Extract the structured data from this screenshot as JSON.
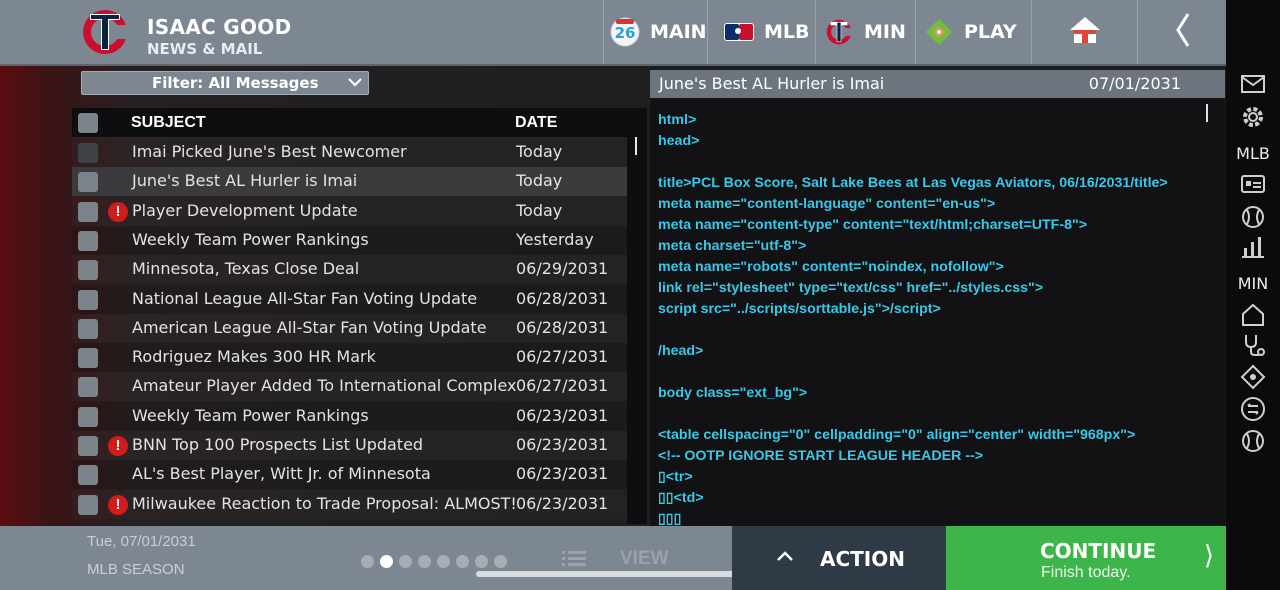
{
  "header": {
    "team_name": "ISAAC GOOD",
    "section": "NEWS & MAIL",
    "nav": [
      {
        "label": "MAIN",
        "icon": "calendar-26-icon"
      },
      {
        "label": "MLB",
        "icon": "mlb-logo-icon"
      },
      {
        "label": "MIN",
        "icon": "twins-logo-icon"
      },
      {
        "label": "PLAY",
        "icon": "baseball-diamond-icon"
      }
    ],
    "home_icon": "home-icon",
    "back_icon": "chevron-left-icon",
    "calendar_day": "26"
  },
  "filter": {
    "label": "Filter: All Messages"
  },
  "list": {
    "columns": {
      "subject": "SUBJECT",
      "date": "DATE"
    },
    "rows": [
      {
        "subject": "Imai Picked June's Best Newcomer",
        "date": "Today",
        "alert": false
      },
      {
        "subject": "June's Best AL Hurler is Imai",
        "date": "Today",
        "alert": false,
        "selected": true
      },
      {
        "subject": "Player Development Update",
        "date": "Today",
        "alert": true
      },
      {
        "subject": "Weekly Team Power Rankings",
        "date": "Yesterday",
        "alert": false
      },
      {
        "subject": "Minnesota, Texas Close Deal",
        "date": "06/29/2031",
        "alert": false
      },
      {
        "subject": "National League All-Star Fan Voting Update",
        "date": "06/28/2031",
        "alert": false
      },
      {
        "subject": "American League All-Star Fan Voting Update",
        "date": "06/28/2031",
        "alert": false
      },
      {
        "subject": "Rodriguez Makes 300 HR Mark",
        "date": "06/27/2031",
        "alert": false
      },
      {
        "subject": "Amateur Player Added To International Complex",
        "date": "06/27/2031",
        "alert": false
      },
      {
        "subject": "Weekly Team Power Rankings",
        "date": "06/23/2031",
        "alert": false
      },
      {
        "subject": "BNN Top 100 Prospects List Updated",
        "date": "06/23/2031",
        "alert": true
      },
      {
        "subject": "AL's Best Player, Witt Jr. of Minnesota",
        "date": "06/23/2031",
        "alert": false
      },
      {
        "subject": "Milwaukee Reaction to Trade Proposal: ALMOST!",
        "date": "06/23/2031",
        "alert": true
      }
    ],
    "alert_glyph": "!"
  },
  "message": {
    "title": "June's Best AL Hurler is Imai",
    "date": "07/01/2031",
    "lines": [
      "html>",
      "head>",
      "",
      "title>PCL Box Score, Salt Lake Bees at Las Vegas Aviators, 06/16/2031/title>",
      "meta name=\"content-language\" content=\"en-us\">",
      "meta name=\"content-type\" content=\"text/html;charset=UTF-8\">",
      "meta charset=\"utf-8\">",
      "meta name=\"robots\" content=\"noindex, nofollow\">",
      "link rel=\"stylesheet\" type=\"text/css\" href=\"../styles.css\">",
      "script src=\"../scripts/sorttable.js\">/script>",
      "",
      "/head>",
      "",
      "body class=\"ext_bg\">",
      "",
      "<table cellspacing=\"0\" cellpadding=\"0\" align=\"center\" width=\"968px\">",
      "<!-- OOTP IGNORE START LEAGUE HEADER -->",
      "▯<tr>",
      "▯▯<td>",
      "▯▯▯"
    ]
  },
  "sidebar": {
    "items": [
      {
        "type": "icon",
        "icon": "mail-icon"
      },
      {
        "type": "icon",
        "icon": "gear-icon"
      },
      {
        "type": "text",
        "label": "MLB"
      },
      {
        "type": "icon",
        "icon": "id-card-icon"
      },
      {
        "type": "icon",
        "icon": "baseball-icon"
      },
      {
        "type": "icon",
        "icon": "bar-chart-icon"
      },
      {
        "type": "text",
        "label": "MIN"
      },
      {
        "type": "icon",
        "icon": "home-outline-icon"
      },
      {
        "type": "icon",
        "icon": "medical-icon"
      },
      {
        "type": "icon",
        "icon": "diamond-icon"
      },
      {
        "type": "icon",
        "icon": "trade-icon"
      },
      {
        "type": "icon",
        "icon": "baseball-icon"
      }
    ]
  },
  "footer": {
    "date": "Tue, 07/01/2031",
    "season": "MLB SEASON",
    "page_dots": 8,
    "active_dot": 1,
    "view_label": "VIEW",
    "action_label": "ACTION",
    "continue_label": "CONTINUE",
    "continue_sub": "Finish today.",
    "continue_arrow": "⟩"
  },
  "colors": {
    "accent_green": "#3db54a",
    "code_cyan": "#39c8e8",
    "alert_red": "#d21c1c",
    "header_gray": "#7d8791"
  }
}
